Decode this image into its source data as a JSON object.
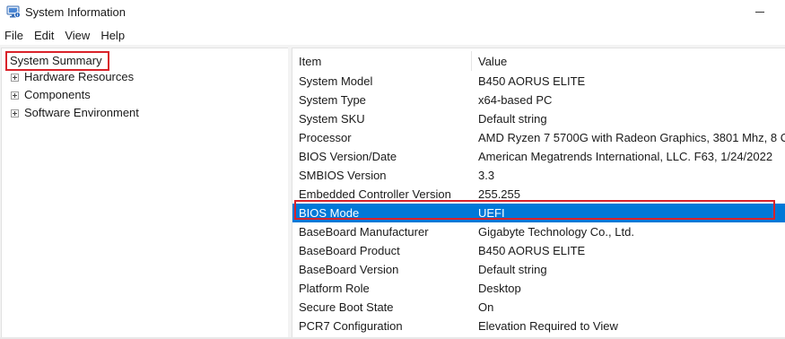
{
  "window": {
    "title": "System Information",
    "icon": "system-information-icon"
  },
  "menu": [
    "File",
    "Edit",
    "View",
    "Help"
  ],
  "tree": {
    "root": "System Summary",
    "children": [
      "Hardware Resources",
      "Components",
      "Software Environment"
    ]
  },
  "table": {
    "columns": [
      "Item",
      "Value"
    ],
    "rows": [
      {
        "item": "System Model",
        "value": "B450 AORUS ELITE"
      },
      {
        "item": "System Type",
        "value": "x64-based PC"
      },
      {
        "item": "System SKU",
        "value": "Default string"
      },
      {
        "item": "Processor",
        "value": "AMD Ryzen 7 5700G with Radeon Graphics, 3801 Mhz, 8 C"
      },
      {
        "item": "BIOS Version/Date",
        "value": "American Megatrends International, LLC. F63, 1/24/2022"
      },
      {
        "item": "SMBIOS Version",
        "value": "3.3"
      },
      {
        "item": "Embedded Controller Version",
        "value": "255.255"
      },
      {
        "item": "BIOS Mode",
        "value": "UEFI"
      },
      {
        "item": "BaseBoard Manufacturer",
        "value": "Gigabyte Technology Co., Ltd."
      },
      {
        "item": "BaseBoard Product",
        "value": "B450 AORUS ELITE"
      },
      {
        "item": "BaseBoard Version",
        "value": "Default string"
      },
      {
        "item": "Platform Role",
        "value": "Desktop"
      },
      {
        "item": "Secure Boot State",
        "value": "On"
      },
      {
        "item": "PCR7 Configuration",
        "value": "Elevation Required to View"
      }
    ],
    "selected_index": 7
  },
  "colors": {
    "selection": "#0078d7",
    "annotation": "#d9222a"
  }
}
